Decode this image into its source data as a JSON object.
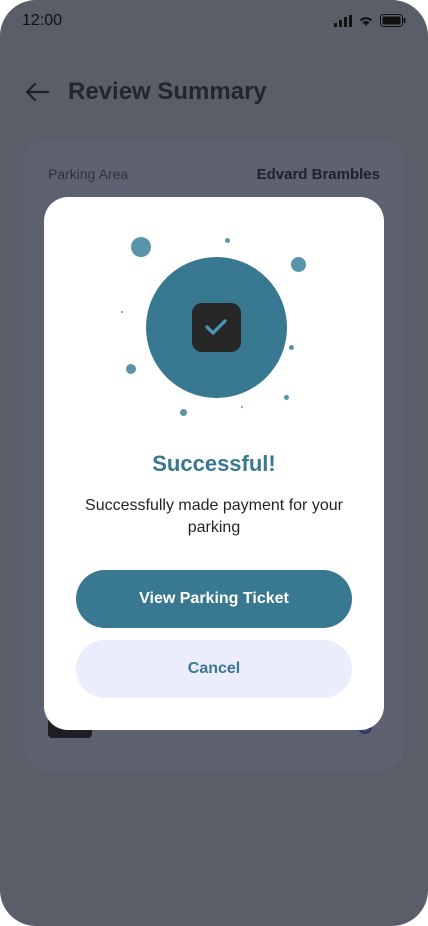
{
  "status_bar": {
    "time": "12:00"
  },
  "header": {
    "title": "Review Summary",
    "back_icon": "arrow-left-icon"
  },
  "summary": {
    "rows": [
      {
        "label": "Parking Area",
        "value": "Edvard Brambles"
      }
    ]
  },
  "modal": {
    "title": "Successful!",
    "message": "Successfully made payment for your parking",
    "primary_button": "View Parking Ticket",
    "secondary_button": "Cancel",
    "icon": "check-icon"
  },
  "colors": {
    "accent": "#387891",
    "overlay_bg": "#5a5e68",
    "secondary_button_bg": "#ecedfb"
  }
}
